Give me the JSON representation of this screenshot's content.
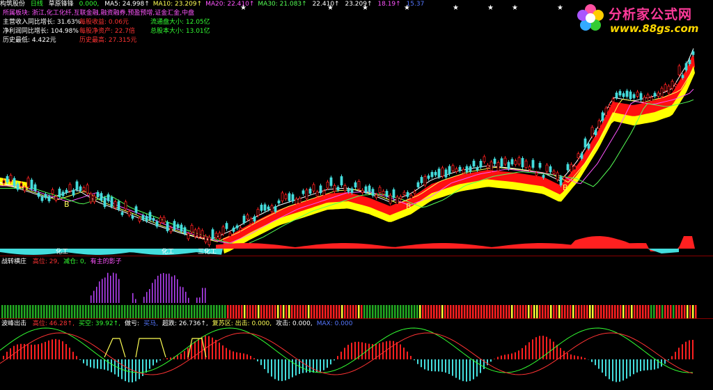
{
  "header": {
    "title": "构筑股份",
    "period": "日线",
    "indicator_name": "草原锋锋",
    "indicator_value": "0.000,",
    "ma": [
      {
        "label": "MA5:",
        "value": "24.998↑",
        "color": "#ffffff"
      },
      {
        "label": "MA10:",
        "value": "23.209↑",
        "color": "#ffff55"
      },
      {
        "label": "MA20:",
        "value": "22.410↑",
        "color": "#ff55ff"
      },
      {
        "label": "MA30:",
        "value": "21.083↑",
        "color": "#55ff55"
      },
      {
        "label": "",
        "value": "22.410↑",
        "color": "#ffffff"
      },
      {
        "label": "",
        "value": "23.209↑",
        "color": "#ffffff"
      },
      {
        "label": "",
        "value": "18.19↑",
        "color": "#ff55ff"
      },
      {
        "label": "",
        "value": "15.37",
        "color": "#5577ff"
      }
    ]
  },
  "info": {
    "sector": "所属板块: 浙江,化工化纤,互联金融,融资融券,预盈预增,证金汇金,中盘",
    "rows": [
      [
        {
          "text": "主营收入同比增长: 31.63%",
          "color": "#ffffff"
        },
        {
          "text": "每股收益: 0.06元",
          "color": "#ff3333"
        },
        {
          "text": "流通盘大小: 12.05亿",
          "color": "#33ff33"
        }
      ],
      [
        {
          "text": "净利润同比增长: 104.98%",
          "color": "#ffffff"
        },
        {
          "text": "每股净资产: 22.7倍",
          "color": "#ff3333"
        },
        {
          "text": "总股本大小: 13.01亿",
          "color": "#33ff33"
        }
      ],
      [
        {
          "text": "历史最低: 4.422元",
          "color": "#ffffff"
        },
        {
          "text": "历史最高: 27.315元",
          "color": "#ff3333"
        },
        {
          "text": "",
          "color": "#33ff33"
        }
      ]
    ]
  },
  "chart_labels": {
    "buy_marker": "B",
    "annotations": [
      "化工",
      "化工",
      "三化工"
    ]
  },
  "panel2": {
    "name": "战转横庄",
    "items": [
      {
        "text": "高位: 29,",
        "color": "#ff3333"
      },
      {
        "text": "减仓: 0,",
        "color": "#33ff33"
      },
      {
        "text": "有主的影子",
        "color": "#ff55ff"
      }
    ]
  },
  "panel3": {
    "name": "波峰出击",
    "items": [
      {
        "text": "高位: 46.28↑,",
        "color": "#ff3333"
      },
      {
        "text": "买空: 39.92↑,",
        "color": "#33ff33"
      },
      {
        "text": "做亏:",
        "color": "#ffffff"
      },
      {
        "text": "买马,",
        "color": "#5577ff"
      },
      {
        "text": "超跌: 26.736↑,",
        "color": "#ffffff"
      },
      {
        "text": "复苏区: 出击: 0.000,",
        "color": "#ffff55"
      },
      {
        "text": "攻击: 0.000,",
        "color": "#ffffff"
      },
      {
        "text": "MAX: 0.000",
        "color": "#5577ff"
      }
    ]
  },
  "logo": {
    "brand": "分析家公式网",
    "url": "www.88gs.com"
  },
  "colors": {
    "up": "#ff2020",
    "down": "#44dddd",
    "band_top": "#ff1010",
    "band_bottom": "#ffff00",
    "background": "#000000"
  }
}
